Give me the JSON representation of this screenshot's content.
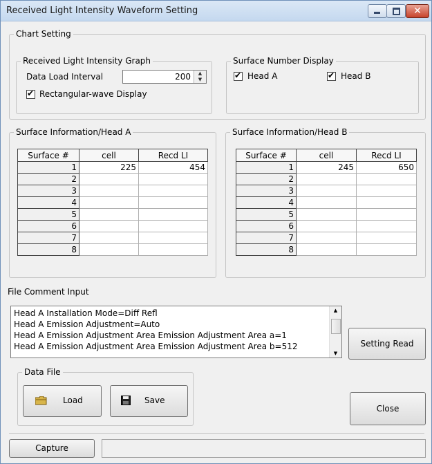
{
  "window": {
    "title": "Received Light Intensity Waveform Setting"
  },
  "chart_setting": {
    "legend": "Chart Setting",
    "graph": {
      "legend": "Received Light Intensity Graph",
      "interval_label": "Data Load Interval",
      "interval_value": "200",
      "rect_label": "Rectangular-wave Display",
      "rect_checked": true
    },
    "surface_display": {
      "legend": "Surface Number Display",
      "head_a_label": "Head A",
      "head_b_label": "Head B",
      "head_a_checked": true,
      "head_b_checked": true
    }
  },
  "surface_a": {
    "legend": "Surface Information/Head A",
    "columns": [
      "Surface #",
      "cell",
      "Recd LI"
    ],
    "rows": [
      [
        "1",
        "225",
        "454"
      ],
      [
        "2",
        "",
        ""
      ],
      [
        "3",
        "",
        ""
      ],
      [
        "4",
        "",
        ""
      ],
      [
        "5",
        "",
        ""
      ],
      [
        "6",
        "",
        ""
      ],
      [
        "7",
        "",
        ""
      ],
      [
        "8",
        "",
        ""
      ]
    ]
  },
  "surface_b": {
    "legend": "Surface Information/Head B",
    "columns": [
      "Surface #",
      "cell",
      "Recd LI"
    ],
    "rows": [
      [
        "1",
        "245",
        "650"
      ],
      [
        "2",
        "",
        ""
      ],
      [
        "3",
        "",
        ""
      ],
      [
        "4",
        "",
        ""
      ],
      [
        "5",
        "",
        ""
      ],
      [
        "6",
        "",
        ""
      ],
      [
        "7",
        "",
        ""
      ],
      [
        "8",
        "",
        ""
      ]
    ]
  },
  "file_comment": {
    "label": "File Comment Input",
    "lines": [
      "Head A Installation Mode=Diff Refl",
      "Head A Emission Adjustment=Auto",
      "Head A Emission Adjustment Area Emission Adjustment Area a=1",
      "Head A Emission Adjustment Area Emission Adjustment Area b=512"
    ]
  },
  "buttons": {
    "setting_read": "Setting Read",
    "load": "Load",
    "save": "Save",
    "close": "Close",
    "capture": "Capture"
  },
  "data_file": {
    "legend": "Data File"
  },
  "icons": {
    "folder": "folder-icon",
    "save": "floppy-disk-icon",
    "minimize": "minimize-icon",
    "maximize": "maximize-icon",
    "close": "close-icon"
  }
}
